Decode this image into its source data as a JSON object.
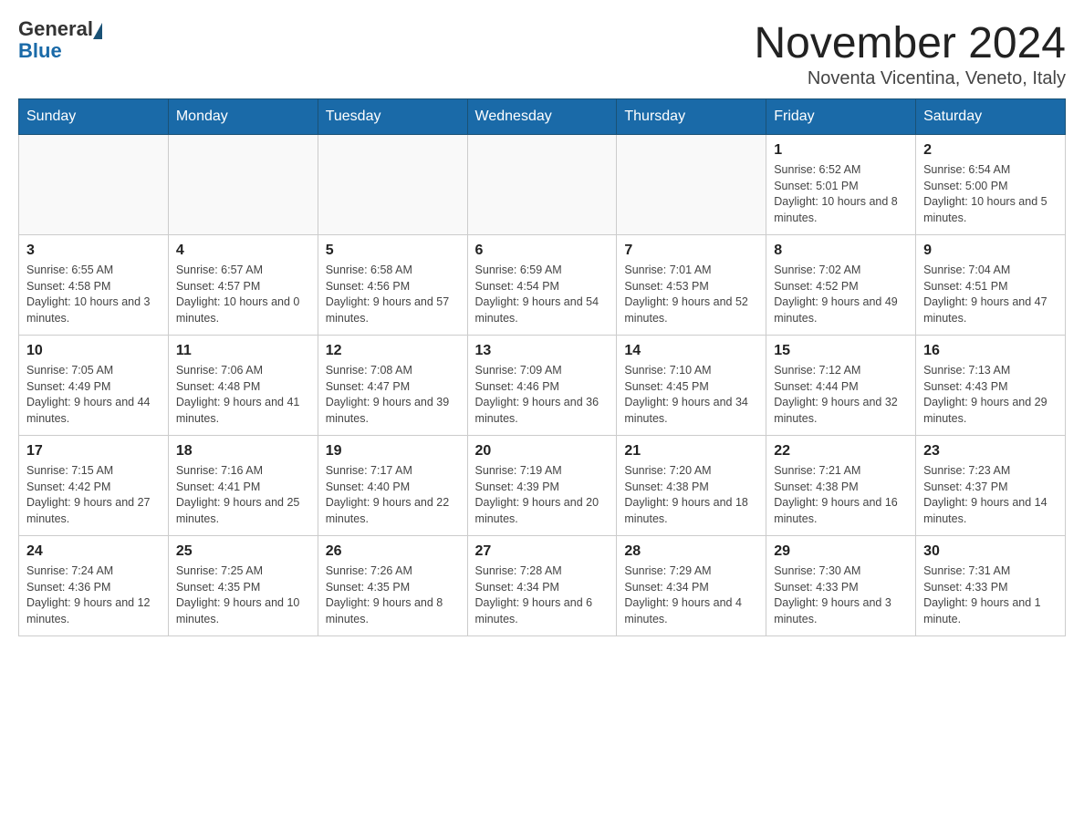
{
  "header": {
    "logo_general": "General",
    "logo_blue": "Blue",
    "month_title": "November 2024",
    "location": "Noventa Vicentina, Veneto, Italy"
  },
  "weekdays": [
    "Sunday",
    "Monday",
    "Tuesday",
    "Wednesday",
    "Thursday",
    "Friday",
    "Saturday"
  ],
  "weeks": [
    {
      "days": [
        {
          "number": "",
          "info": ""
        },
        {
          "number": "",
          "info": ""
        },
        {
          "number": "",
          "info": ""
        },
        {
          "number": "",
          "info": ""
        },
        {
          "number": "",
          "info": ""
        },
        {
          "number": "1",
          "info": "Sunrise: 6:52 AM\nSunset: 5:01 PM\nDaylight: 10 hours and 8 minutes."
        },
        {
          "number": "2",
          "info": "Sunrise: 6:54 AM\nSunset: 5:00 PM\nDaylight: 10 hours and 5 minutes."
        }
      ]
    },
    {
      "days": [
        {
          "number": "3",
          "info": "Sunrise: 6:55 AM\nSunset: 4:58 PM\nDaylight: 10 hours and 3 minutes."
        },
        {
          "number": "4",
          "info": "Sunrise: 6:57 AM\nSunset: 4:57 PM\nDaylight: 10 hours and 0 minutes."
        },
        {
          "number": "5",
          "info": "Sunrise: 6:58 AM\nSunset: 4:56 PM\nDaylight: 9 hours and 57 minutes."
        },
        {
          "number": "6",
          "info": "Sunrise: 6:59 AM\nSunset: 4:54 PM\nDaylight: 9 hours and 54 minutes."
        },
        {
          "number": "7",
          "info": "Sunrise: 7:01 AM\nSunset: 4:53 PM\nDaylight: 9 hours and 52 minutes."
        },
        {
          "number": "8",
          "info": "Sunrise: 7:02 AM\nSunset: 4:52 PM\nDaylight: 9 hours and 49 minutes."
        },
        {
          "number": "9",
          "info": "Sunrise: 7:04 AM\nSunset: 4:51 PM\nDaylight: 9 hours and 47 minutes."
        }
      ]
    },
    {
      "days": [
        {
          "number": "10",
          "info": "Sunrise: 7:05 AM\nSunset: 4:49 PM\nDaylight: 9 hours and 44 minutes."
        },
        {
          "number": "11",
          "info": "Sunrise: 7:06 AM\nSunset: 4:48 PM\nDaylight: 9 hours and 41 minutes."
        },
        {
          "number": "12",
          "info": "Sunrise: 7:08 AM\nSunset: 4:47 PM\nDaylight: 9 hours and 39 minutes."
        },
        {
          "number": "13",
          "info": "Sunrise: 7:09 AM\nSunset: 4:46 PM\nDaylight: 9 hours and 36 minutes."
        },
        {
          "number": "14",
          "info": "Sunrise: 7:10 AM\nSunset: 4:45 PM\nDaylight: 9 hours and 34 minutes."
        },
        {
          "number": "15",
          "info": "Sunrise: 7:12 AM\nSunset: 4:44 PM\nDaylight: 9 hours and 32 minutes."
        },
        {
          "number": "16",
          "info": "Sunrise: 7:13 AM\nSunset: 4:43 PM\nDaylight: 9 hours and 29 minutes."
        }
      ]
    },
    {
      "days": [
        {
          "number": "17",
          "info": "Sunrise: 7:15 AM\nSunset: 4:42 PM\nDaylight: 9 hours and 27 minutes."
        },
        {
          "number": "18",
          "info": "Sunrise: 7:16 AM\nSunset: 4:41 PM\nDaylight: 9 hours and 25 minutes."
        },
        {
          "number": "19",
          "info": "Sunrise: 7:17 AM\nSunset: 4:40 PM\nDaylight: 9 hours and 22 minutes."
        },
        {
          "number": "20",
          "info": "Sunrise: 7:19 AM\nSunset: 4:39 PM\nDaylight: 9 hours and 20 minutes."
        },
        {
          "number": "21",
          "info": "Sunrise: 7:20 AM\nSunset: 4:38 PM\nDaylight: 9 hours and 18 minutes."
        },
        {
          "number": "22",
          "info": "Sunrise: 7:21 AM\nSunset: 4:38 PM\nDaylight: 9 hours and 16 minutes."
        },
        {
          "number": "23",
          "info": "Sunrise: 7:23 AM\nSunset: 4:37 PM\nDaylight: 9 hours and 14 minutes."
        }
      ]
    },
    {
      "days": [
        {
          "number": "24",
          "info": "Sunrise: 7:24 AM\nSunset: 4:36 PM\nDaylight: 9 hours and 12 minutes."
        },
        {
          "number": "25",
          "info": "Sunrise: 7:25 AM\nSunset: 4:35 PM\nDaylight: 9 hours and 10 minutes."
        },
        {
          "number": "26",
          "info": "Sunrise: 7:26 AM\nSunset: 4:35 PM\nDaylight: 9 hours and 8 minutes."
        },
        {
          "number": "27",
          "info": "Sunrise: 7:28 AM\nSunset: 4:34 PM\nDaylight: 9 hours and 6 minutes."
        },
        {
          "number": "28",
          "info": "Sunrise: 7:29 AM\nSunset: 4:34 PM\nDaylight: 9 hours and 4 minutes."
        },
        {
          "number": "29",
          "info": "Sunrise: 7:30 AM\nSunset: 4:33 PM\nDaylight: 9 hours and 3 minutes."
        },
        {
          "number": "30",
          "info": "Sunrise: 7:31 AM\nSunset: 4:33 PM\nDaylight: 9 hours and 1 minute."
        }
      ]
    }
  ]
}
